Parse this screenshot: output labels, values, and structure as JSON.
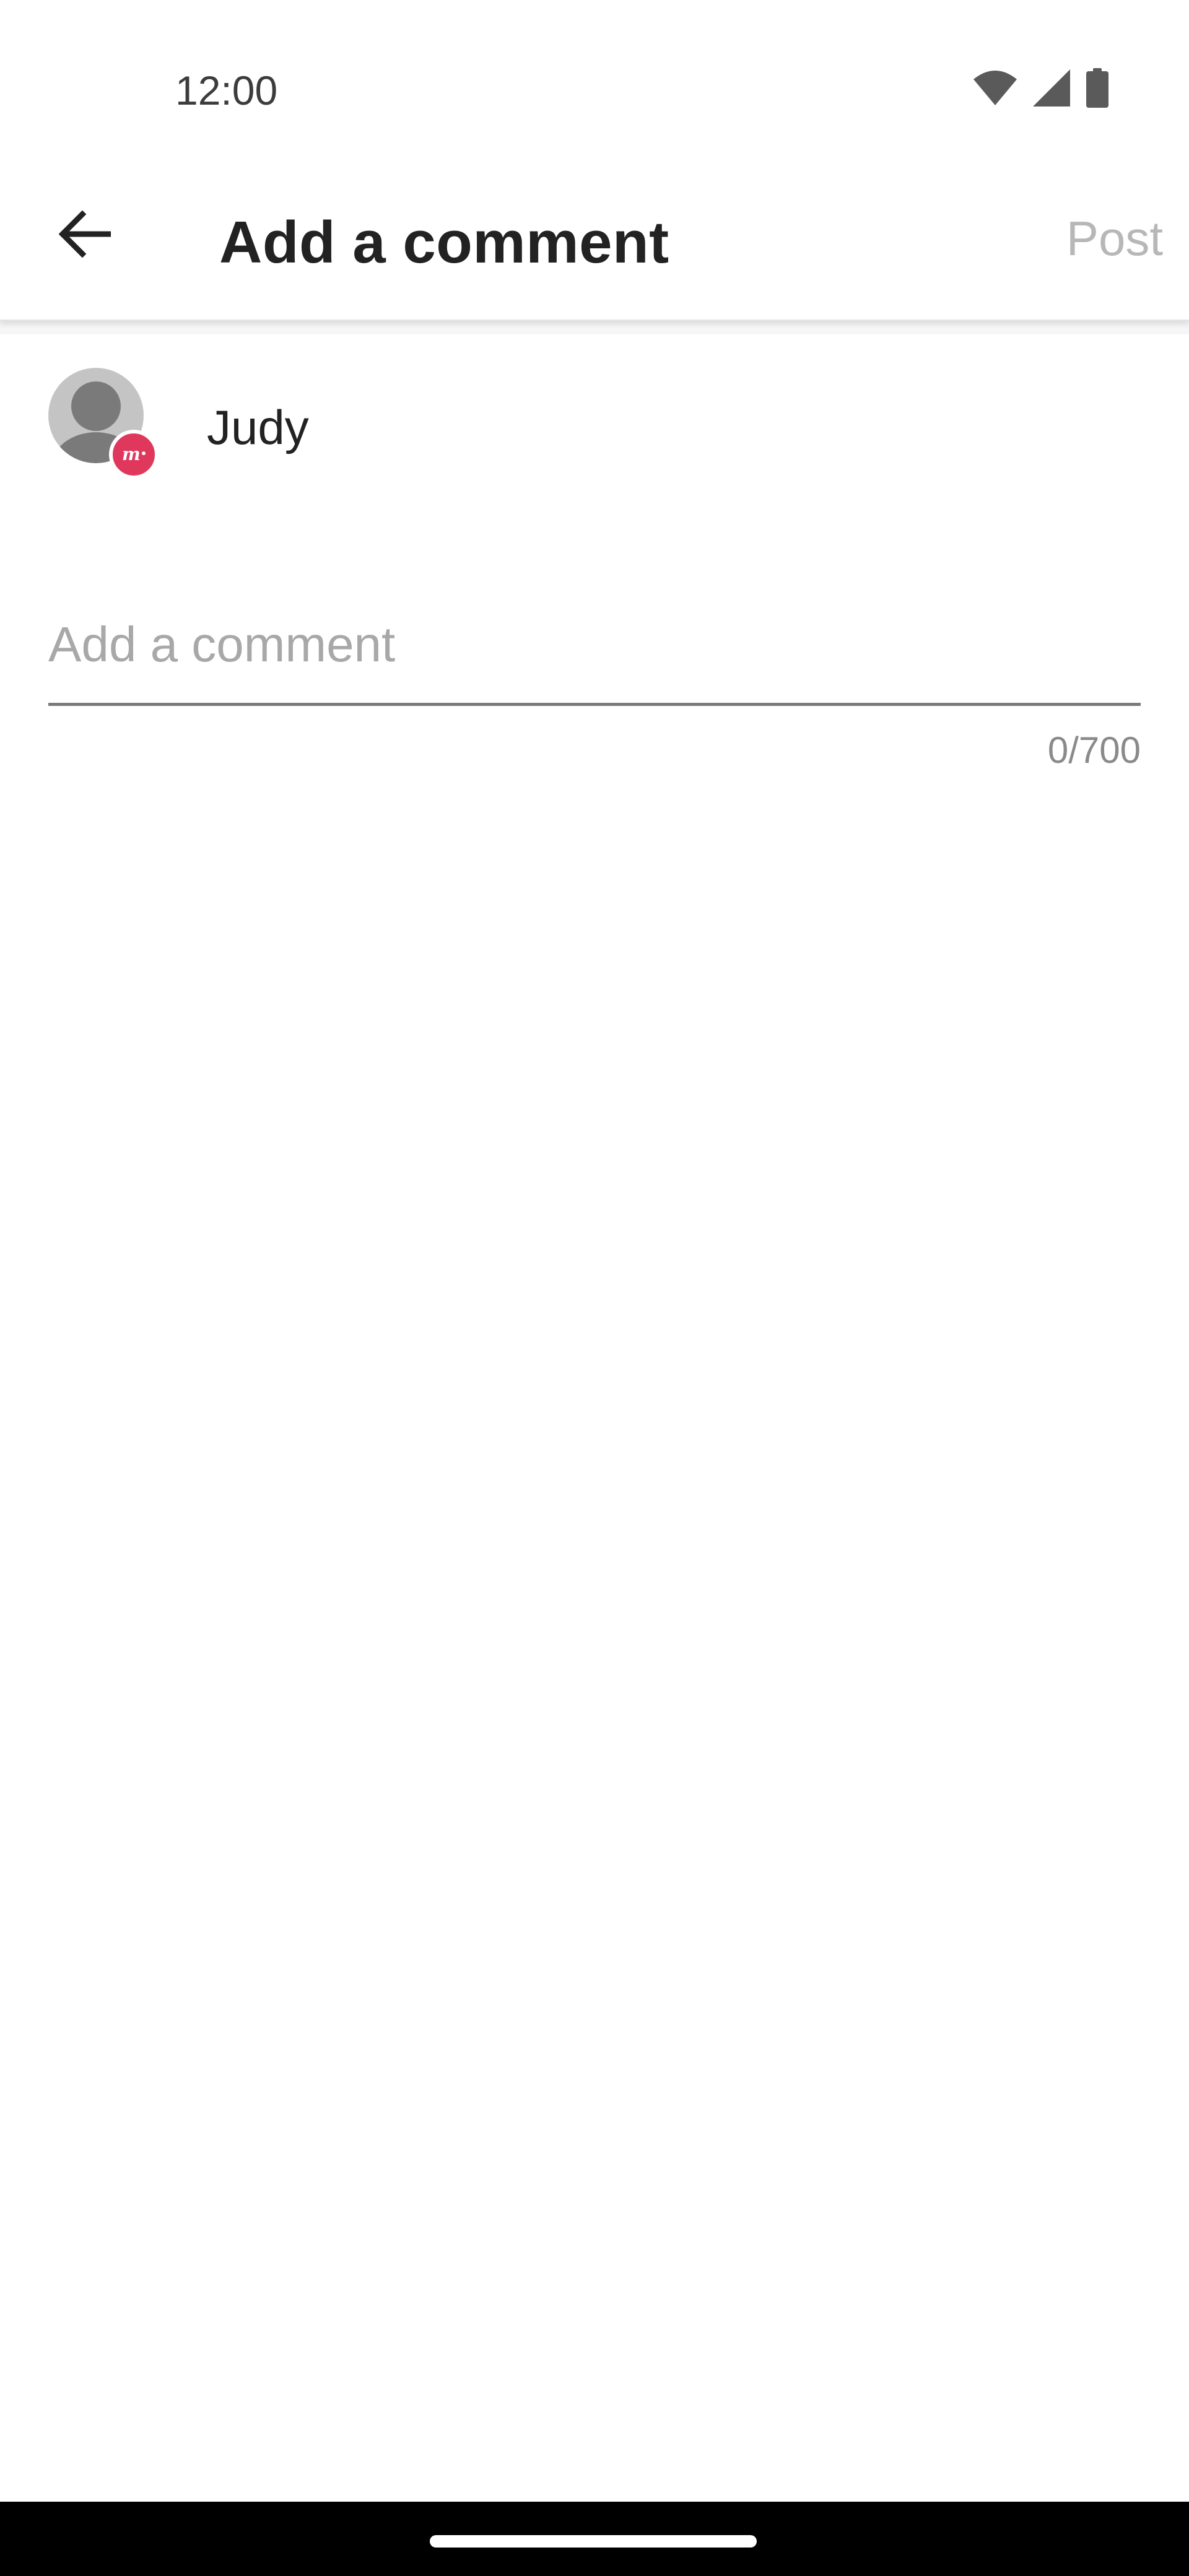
{
  "status_bar": {
    "time": "12:00",
    "icons": [
      "wifi-icon",
      "signal-icon",
      "battery-icon"
    ]
  },
  "app_bar": {
    "back_icon": "arrow-left-icon",
    "title": "Add a comment",
    "post_label": "Post"
  },
  "user": {
    "name": "Judy",
    "avatar_icon": "default-avatar-icon",
    "badge_icon": "meetup-plus-badge-icon",
    "badge_color": "#e0385c"
  },
  "comment": {
    "value": "",
    "placeholder": "Add a comment",
    "counter": "0/700"
  },
  "colors": {
    "title": "#222222",
    "post_disabled": "#b7b7b7",
    "placeholder": "#a8a8a8",
    "underline": "#7a7a7a"
  }
}
